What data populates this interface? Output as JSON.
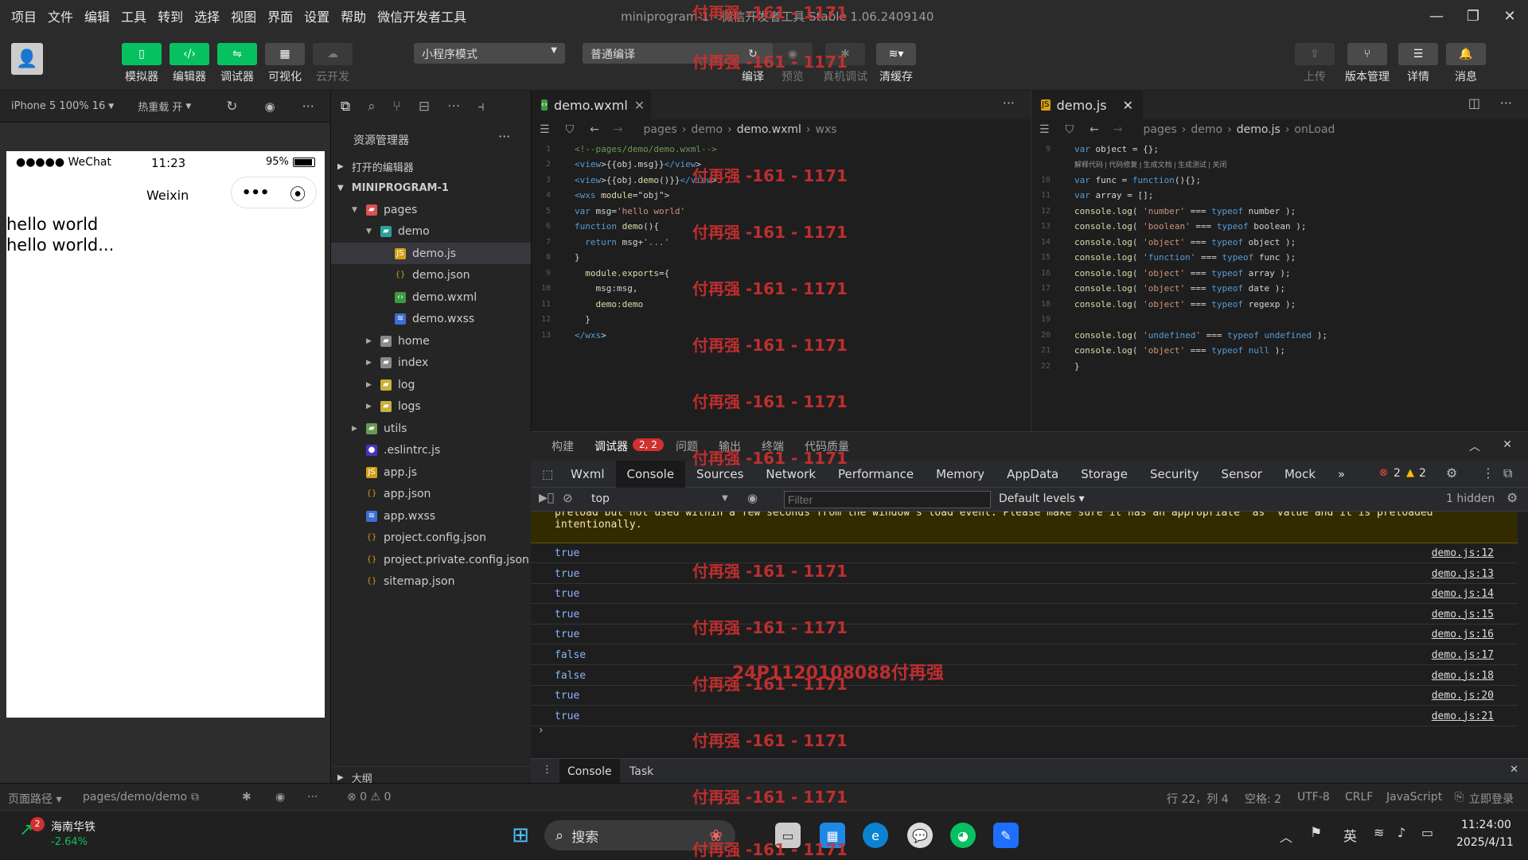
{
  "menu": [
    "项目",
    "文件",
    "编辑",
    "工具",
    "转到",
    "选择",
    "视图",
    "界面",
    "设置",
    "帮助",
    "微信开发者工具"
  ],
  "window_title": "miniprogram-1 - 微信开发者工具 Stable 1.06.2409140",
  "toolbar": {
    "left": [
      "模拟器",
      "编辑器",
      "调试器",
      "可视化",
      "云开发"
    ],
    "mode_select": "小程序模式",
    "compile_select": "普通编译",
    "actions": [
      "编译",
      "预览",
      "真机调试",
      "清缓存"
    ],
    "right": [
      "上传",
      "版本管理",
      "详情",
      "消息"
    ]
  },
  "simulator": {
    "device": "iPhone 5 100% 16",
    "hot_reload": "热重载 开",
    "status_carrier": "●●●●● WeChat",
    "status_time": "11:23",
    "status_battery": "95%",
    "nav_title": "Weixin",
    "lines": [
      "hello world",
      "hello world..."
    ]
  },
  "explorer": {
    "title": "资源管理器",
    "open_editors": "打开的编辑器",
    "root": "MINIPROGRAM-1",
    "items": [
      {
        "name": "pages",
        "depth": 1,
        "type": "folder-red",
        "open": true
      },
      {
        "name": "demo",
        "depth": 2,
        "type": "folder-teal",
        "open": true
      },
      {
        "name": "demo.js",
        "depth": 3,
        "type": "js",
        "active": true
      },
      {
        "name": "demo.json",
        "depth": 3,
        "type": "json"
      },
      {
        "name": "demo.wxml",
        "depth": 3,
        "type": "wxml"
      },
      {
        "name": "demo.wxss",
        "depth": 3,
        "type": "wxss"
      },
      {
        "name": "home",
        "depth": 2,
        "type": "folder",
        "open": false
      },
      {
        "name": "index",
        "depth": 2,
        "type": "folder",
        "open": false
      },
      {
        "name": "log",
        "depth": 2,
        "type": "folder-yellow",
        "open": false
      },
      {
        "name": "logs",
        "depth": 2,
        "type": "folder-yellow",
        "open": false
      },
      {
        "name": "utils",
        "depth": 1,
        "type": "folder-green",
        "open": false
      },
      {
        "name": ".eslintrc.js",
        "depth": 1,
        "type": "eslint"
      },
      {
        "name": "app.js",
        "depth": 1,
        "type": "js"
      },
      {
        "name": "app.json",
        "depth": 1,
        "type": "json"
      },
      {
        "name": "app.wxss",
        "depth": 1,
        "type": "wxss"
      },
      {
        "name": "project.config.json",
        "depth": 1,
        "type": "json"
      },
      {
        "name": "project.private.config.json",
        "depth": 1,
        "type": "json"
      },
      {
        "name": "sitemap.json",
        "depth": 1,
        "type": "json"
      }
    ],
    "outline": "大纲",
    "problems": "⊗ 0 ⚠ 0"
  },
  "editor1": {
    "tab": "demo.wxml",
    "crumbs": [
      "pages",
      "demo",
      "demo.wxml",
      "wxs"
    ],
    "lines": [
      {
        "n": "1",
        "t": "<!--pages/demo/demo.wxml-->"
      },
      {
        "n": "2",
        "t": "<view>{{obj.msg}}</view>"
      },
      {
        "n": "3",
        "t": "<view>{{obj.demo()}}</view>"
      },
      {
        "n": "4",
        "t": "<wxs module=\"obj\">"
      },
      {
        "n": "5",
        "t": "var msg='hello world'"
      },
      {
        "n": "6",
        "t": "function demo(){"
      },
      {
        "n": "7",
        "t": "  return msg+'...'"
      },
      {
        "n": "8",
        "t": "}"
      },
      {
        "n": "9",
        "t": "  module.exports={"
      },
      {
        "n": "10",
        "t": "    msg:msg,"
      },
      {
        "n": "11",
        "t": "    demo:demo"
      },
      {
        "n": "12",
        "t": "  }"
      },
      {
        "n": "13",
        "t": "</wxs>"
      }
    ]
  },
  "editor2": {
    "tab": "demo.js",
    "crumbs": [
      "pages",
      "demo",
      "demo.js",
      "onLoad"
    ],
    "codelens": "解释代码 | 代码修复 | 生成文档 | 生成测试 | 关闭",
    "lines": [
      {
        "n": "9",
        "t": "var object = {};"
      },
      {
        "n": "",
        "t": ""
      },
      {
        "n": "10",
        "t": "var func = function(){};"
      },
      {
        "n": "11",
        "t": "var array = [];"
      },
      {
        "n": "12",
        "t": "console.log( 'number' === typeof number );"
      },
      {
        "n": "13",
        "t": "console.log( 'boolean' === typeof boolean );"
      },
      {
        "n": "14",
        "t": "console.log( 'object' === typeof object );"
      },
      {
        "n": "15",
        "t": "console.log( 'function' === typeof func );"
      },
      {
        "n": "16",
        "t": "console.log( 'object' === typeof array );"
      },
      {
        "n": "17",
        "t": "console.log( 'object' === typeof date );"
      },
      {
        "n": "18",
        "t": "console.log( 'object' === typeof regexp );"
      },
      {
        "n": "19",
        "t": ""
      },
      {
        "n": "20",
        "t": "console.log( 'undefined' === typeof undefined );"
      },
      {
        "n": "21",
        "t": "console.log( 'object' === typeof null );"
      },
      {
        "n": "22",
        "t": "}"
      }
    ]
  },
  "panel": {
    "tabs": [
      "构建",
      "调试器",
      "问题",
      "输出",
      "终端",
      "代码质量"
    ],
    "debug_badge": "2, 2",
    "devtools_tabs": [
      "Wxml",
      "Console",
      "Sources",
      "Network",
      "Performance",
      "Memory",
      "AppData",
      "Storage",
      "Security",
      "Sensor",
      "Mock",
      "»"
    ],
    "errors": "2",
    "warnings": "2",
    "context": "top",
    "filter_placeholder": "Filter",
    "levels": "Default levels ▾",
    "hidden": "1 hidden",
    "warning_text": "preload but not used within a few seconds from the window's load event. Please make sure it has an appropriate `as` value and it is preloaded",
    "warning_text2": "intentionally.",
    "logs": [
      {
        "v": "true",
        "s": "demo.js:12"
      },
      {
        "v": "true",
        "s": "demo.js:13"
      },
      {
        "v": "true",
        "s": "demo.js:14"
      },
      {
        "v": "true",
        "s": "demo.js:15"
      },
      {
        "v": "true",
        "s": "demo.js:16"
      },
      {
        "v": "false",
        "s": "demo.js:17"
      },
      {
        "v": "false",
        "s": "demo.js:18"
      },
      {
        "v": "true",
        "s": "demo.js:20"
      },
      {
        "v": "true",
        "s": "demo.js:21"
      }
    ],
    "drawer_tabs": [
      "Console",
      "Task"
    ]
  },
  "status": {
    "page_path_label": "页面路径 ▾",
    "page_path": "pages/demo/demo",
    "position": "行 22，列 4",
    "spaces": "空格: 2",
    "encoding": "UTF-8",
    "eol": "CRLF",
    "lang": "JavaScript",
    "login": "立即登录"
  },
  "taskbar": {
    "stock_name": "海南华铁",
    "stock_change": "-2.64%",
    "stock_badge": "2",
    "search": "搜索",
    "ime": "英",
    "time": "11:24:00",
    "date": "2025/4/11"
  },
  "watermark": "付再强 -161 - 1171",
  "watermark2": "24P1120108088付再强",
  "colors": {
    "green": "#07c160",
    "red_wm": "#d03030"
  }
}
